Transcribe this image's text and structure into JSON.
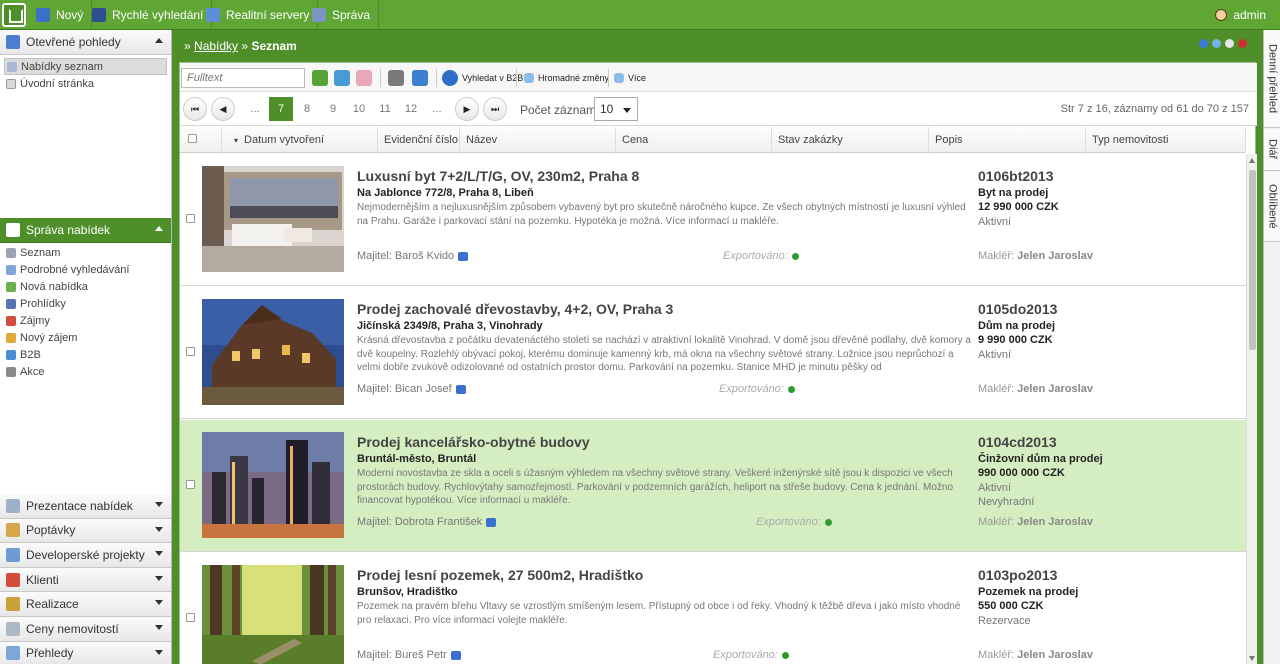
{
  "topbar": {
    "nav": [
      {
        "label": "Nový",
        "icon": "new-icon"
      },
      {
        "label": "Rychlé vyhledání",
        "icon": "quick-search-icon"
      },
      {
        "label": "Realitní servery",
        "icon": "servers-icon"
      },
      {
        "label": "Správa",
        "icon": "admin-icon"
      }
    ],
    "user": "admin"
  },
  "left": {
    "open_views": {
      "title": "Otevřené pohledy",
      "items": [
        "Nabídky seznam",
        "Úvodní stránka"
      ]
    },
    "offers": {
      "title": "Správa nabídek",
      "items": [
        "Seznam",
        "Podrobné vyhledávání",
        "Nová nabídka",
        "Prohlídky",
        "Zájmy",
        "Nový zájem",
        "B2B",
        "Akce"
      ]
    },
    "sections": [
      "Prezentace nabídek",
      "Poptávky",
      "Developerské projekty",
      "Klienti",
      "Realizace",
      "Ceny nemovitostí",
      "Přehledy"
    ]
  },
  "right_tabs": [
    "Denní přehled",
    "Diář",
    "Oblíbené"
  ],
  "breadcrumb": {
    "link": "Nabídky",
    "sep": "»",
    "current": "Seznam"
  },
  "toolbar": {
    "fulltext_placeholder": "Fulltext",
    "search_b2b": "Vyhledat v B2B",
    "bulk_changes": "Hromadné změny",
    "more": "Více"
  },
  "pager": {
    "ellipsis": "...",
    "pages": [
      "7",
      "8",
      "9",
      "10",
      "11",
      "12"
    ],
    "current": "7",
    "count_label": "Počet záznamů",
    "count_value": "10",
    "info": "Str 7 z 16, záznamy od 61 do 70 z 157",
    "first": "⏮",
    "prev": "◀",
    "next": "▶",
    "last": "⏭"
  },
  "table": {
    "sort_indicator": "▾",
    "columns": [
      "Datum vytvoření",
      "Evidenční číslo",
      "Název",
      "Cena",
      "Stav zakázky",
      "Popis",
      "Typ nemovitosti"
    ],
    "owner_label": "Majitel:",
    "exported_label": "Exportováno:",
    "agent_label": "Makléř:",
    "rows": [
      {
        "title": "Luxusní byt 7+2/L/T/G, OV, 230m2, Praha 8",
        "address": "Na Jablonce 772/8, Praha 8, Libeň",
        "description": "Nejmodernějším a nejluxusnějším způsobem vybavený byt pro skutečně náročného kupce. Ze všech obytných místností je luxusní výhled na Prahu. Garáže i parkovací stání na pozemku. Hypotéka je možná. Více informací u makléře.",
        "owner": "Baroš Kvido",
        "code": "0106bt2013",
        "type": "Byt na prodej",
        "price": "12 990 000 CZK",
        "status": [
          "Aktivní"
        ],
        "agent": "Jelen Jaroslav",
        "highlight": false
      },
      {
        "title": "Prodej zachovalé dřevostavby, 4+2, OV, Praha 3",
        "address": "Jičínská 2349/8, Praha 3, Vinohrady",
        "description": "Krásná dřevostavba z počátku devatenáctého století se nachází v atraktivní lokalitě Vinohrad. V domě jsou dřevěné podlahy, dvě komory a dvě koupelny. Rozlehlý obývací pokoj, kterému dominuje kamenný krb, má okna na všechny světové strany. Ložnice jsou neprůchozí a velmi dobře zvukově odizolované od ostatních prostor domu. Parkování na pozemku. Stanice MHD je minutu pěšky od",
        "owner": "Bican Josef",
        "code": "0105do2013",
        "type": "Dům na prodej",
        "price": "9 990 000 CZK",
        "status": [
          "Aktivní"
        ],
        "agent": "Jelen Jaroslav",
        "highlight": false
      },
      {
        "title": "Prodej kancelářsko-obytné budovy",
        "address": "Bruntál-město, Bruntál",
        "description": "Moderní novostavba ze skla a oceli s úžasným výhledem na všechny světové strany. Veškeré inženýrské sítě jsou k dispozici ve všech prostorách budovy. Rychlovýtahy samozřejmostí. Parkování v podzemních garážích, heliport na střeše budovy. Cena k jednání. Možno financovat hypotékou. Více informací u makléře.",
        "owner": "Dobrota František",
        "code": "0104cd2013",
        "type": "Činžovní dům na prodej",
        "price": "990 000 000 CZK",
        "status": [
          "Aktivní",
          "Nevyhradní"
        ],
        "agent": "Jelen Jaroslav",
        "highlight": true
      },
      {
        "title": "Prodej lesní pozemek, 27 500m2, Hradištko",
        "address": "Brunšov, Hradištko",
        "description": "Pozemek na pravém břehu Vltavy se vzrostlým smíšeným lesem. Přístupný od obce i od řeky. Vhodný k těžbě dřeva i jako místo vhodné pro relaxaci. Pro více informací volejte makléře.",
        "owner": "Bureš Petr",
        "code": "0103po2013",
        "type": "Pozemek na prodej",
        "price": "550 000 CZK",
        "status": [
          "Rezervace"
        ],
        "agent": "Jelen Jaroslav",
        "highlight": false
      }
    ]
  },
  "colors": {
    "brand": "#5fa634",
    "brand_dark": "#4e8f2a",
    "highlight_row": "#d5eec1",
    "export_ok": "#2e9b2e"
  }
}
